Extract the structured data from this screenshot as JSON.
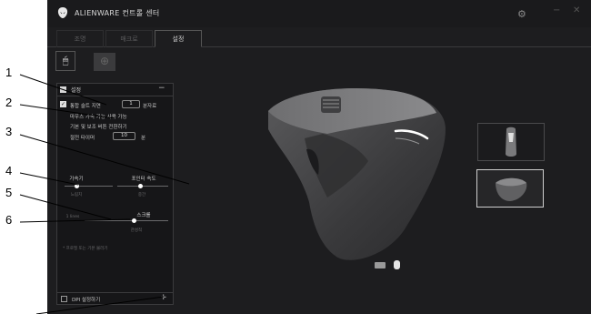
{
  "callouts": [
    "1",
    "2",
    "3",
    "4",
    "5",
    "6"
  ],
  "app": {
    "title": "ALIENWARE 컨트롤 센터",
    "tabs": [
      {
        "label": "조명",
        "active": false
      },
      {
        "label": "매크로",
        "active": false
      },
      {
        "label": "설정",
        "active": true
      }
    ]
  },
  "panel": {
    "title": "설정",
    "collapse_symbol": "−",
    "sleep_timeout": {
      "checked": true,
      "label": "통합 슬트 지연",
      "value": "1",
      "unit": "분자료"
    },
    "line2": "마우스 가속 가능 사용 가능",
    "line3": "기본 및 보조 버튼 전환하기",
    "idle_timer": {
      "label": "절전 타이머",
      "value": "10",
      "unit": "분"
    },
    "acceleration": {
      "label": "가속기",
      "value_label": "느림치"
    },
    "pointer_speed": {
      "label": "포인터 속도",
      "value_label": "중간"
    },
    "scroll": {
      "label": "스크롤",
      "value_label": "관성적",
      "left_label": "1 lines"
    },
    "note": "* 프로필 또는 기본 불러기",
    "footer_label": "DPI 설정하기",
    "footer_plus": "+"
  },
  "icons": {
    "logo": "alienware-logo-icon",
    "settings": "gear-icon",
    "minimize": "minimize-icon",
    "close": "close-icon",
    "device_mouse": "mouse-icon",
    "device_other": "crosshair-icon",
    "view_keyboard": "keyboard-icon",
    "view_mouse": "mouse-icon"
  },
  "colors": {
    "background": "#1d1d1f",
    "panel": "#161618",
    "accent": "#ffffff"
  }
}
